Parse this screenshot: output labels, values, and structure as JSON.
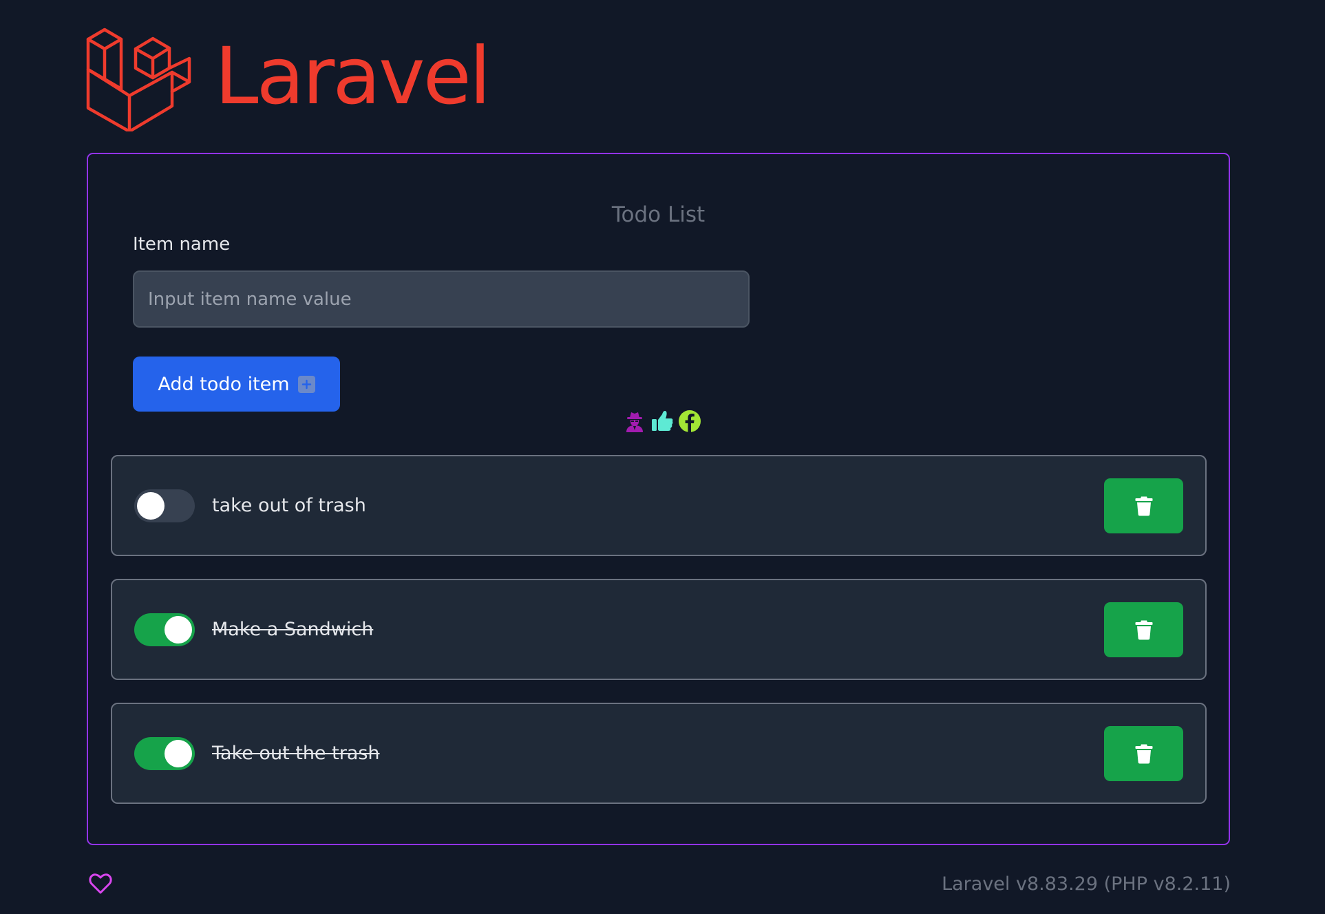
{
  "brand": {
    "name": "Laravel"
  },
  "todo": {
    "title": "Todo List",
    "item_label": "Item name",
    "input": {
      "placeholder": "Input item name value",
      "value": ""
    },
    "add_button_label": "Add todo item",
    "icons": [
      "user-secret-icon",
      "thumbs-up-icon",
      "facebook-icon"
    ],
    "items": [
      {
        "label": "take out of trash",
        "completed": false
      },
      {
        "label": "Make a Sandwich",
        "completed": true
      },
      {
        "label": "Take out the trash",
        "completed": true
      }
    ]
  },
  "footer": {
    "version": "Laravel v8.83.29 (PHP v8.2.11)"
  },
  "colors": {
    "background": "#111827",
    "brand": "#ef3b2d",
    "card_border": "#9333ea",
    "primary": "#2563eb",
    "success": "#16a34a",
    "heart": "#d946ef"
  }
}
